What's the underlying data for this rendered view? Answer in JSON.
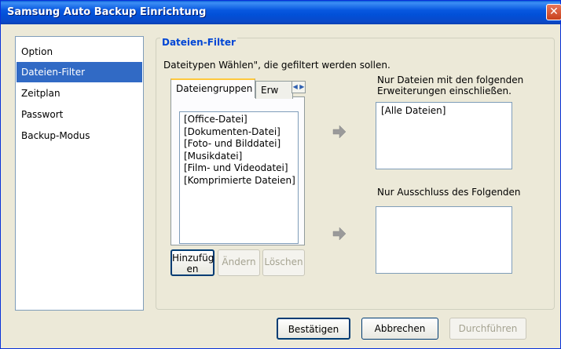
{
  "window": {
    "title": "Samsung Auto Backup Einrichtung"
  },
  "sidebar": {
    "items": [
      {
        "label": "Option"
      },
      {
        "label": "Dateien-Filter"
      },
      {
        "label": "Zeitplan"
      },
      {
        "label": "Passwort"
      },
      {
        "label": "Backup-Modus"
      }
    ]
  },
  "filter": {
    "group_title": "Dateien-Filter",
    "description": "Dateitypen Wählen\", die gefiltert werden sollen.",
    "tabs": [
      {
        "label": "Dateiengruppen"
      },
      {
        "label": "Erw"
      }
    ],
    "groups": [
      "[Office-Datei]",
      "[Dokumenten-Datei]",
      "[Foto- und Bilddatei]",
      "[Musikdatei]",
      "[Film- und Videodatei]",
      "[Komprimierte Dateien]"
    ],
    "add_label_1": "Hinzufüg",
    "add_label_2": "en",
    "edit_label": "Ändern",
    "delete_label": "Löschen",
    "include_label_1": "Nur Dateien mit den folgenden",
    "include_label_2": "Erweiterungen einschließen.",
    "include_items": [
      "[Alle Dateien]"
    ],
    "exclude_label": "Nur Ausschluss des Folgenden"
  },
  "footer": {
    "confirm": "Bestätigen",
    "cancel": "Abbrechen",
    "run": "Durchführen"
  }
}
